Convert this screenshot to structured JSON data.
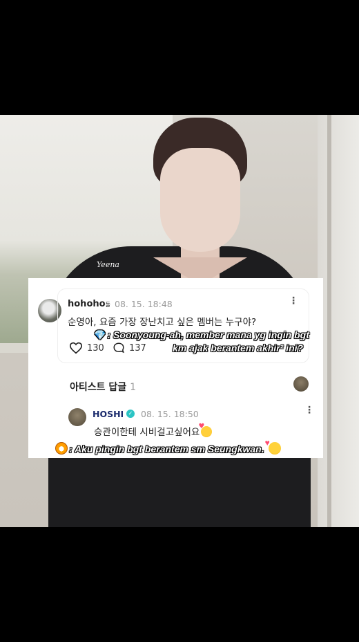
{
  "photo": {
    "watermark": "Yeena"
  },
  "comment": {
    "username": "hohoho",
    "username_suffix": "둘",
    "timestamp": "08. 15. 18:48",
    "text": "순영아, 요즘 가장 장난치고 싶은 멤버는 누구야?",
    "likes": "130",
    "replies": "137"
  },
  "reply_section": {
    "label": "아티스트 답글",
    "count": "1"
  },
  "artist_reply": {
    "name": "HOSHI",
    "timestamp": "08. 15. 18:50",
    "text": "승관이한테 시비걸고싶어요"
  },
  "overlay": {
    "translation_q_line1": ": Soonyoung-ah, member mana yg ingin bgt",
    "translation_q_line2": "km ajak berantem akhir² ini?",
    "translation_a": ": Aku pingin bgt berantem sm Seungkwan."
  },
  "icons": {
    "comment_avatar": "user-avatar-icon",
    "like": "heart-outline-icon",
    "reply": "speech-bubble-icon",
    "menu": "vertical-ellipsis-icon",
    "verified": "verified-badge-icon",
    "gem": "gem-emoji-icon",
    "tiger": "tiger-emoji-icon",
    "smiling_hearts": "smiling-face-with-hearts-emoji-icon"
  },
  "colors": {
    "artist_name": "#1a2a6c",
    "verified": "#2bc4c4",
    "overlay_gem": "#5fc9ff"
  }
}
